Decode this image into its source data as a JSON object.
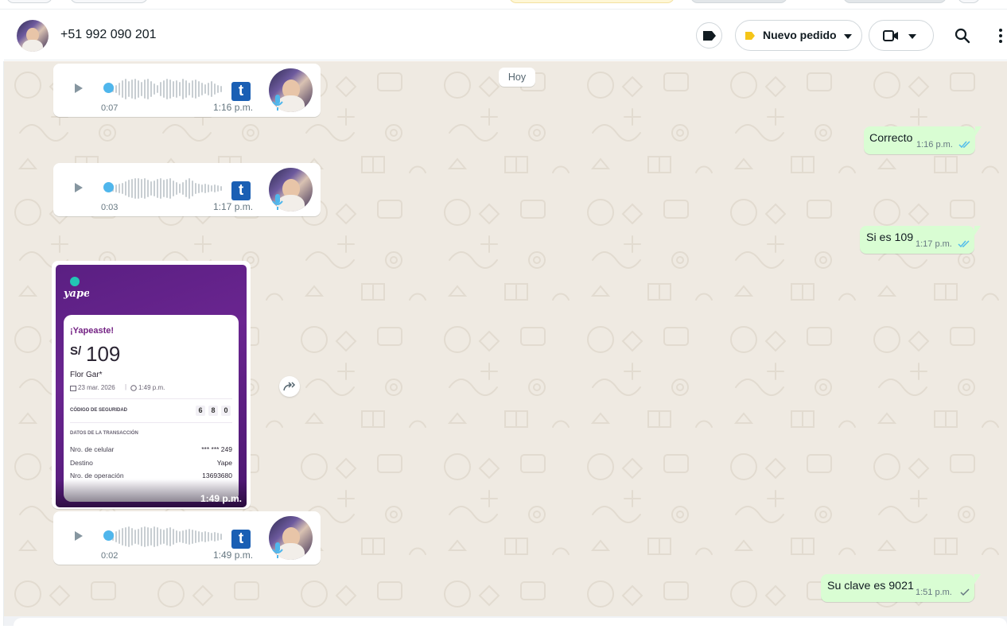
{
  "header": {
    "contact_name": "+51 992 090 201",
    "label_button": "Nuevo pedido",
    "label_color": "#f5c518",
    "icons": [
      "label-icon",
      "video-call-icon",
      "chevron-down-icon",
      "search-icon",
      "menu-icon"
    ]
  },
  "chat": {
    "day_divider": "Hoy",
    "outgoing": [
      {
        "text": "Correcto",
        "time": "1:16 p.m.",
        "status": "read"
      },
      {
        "text": "Si es 109",
        "time": "1:17 p.m.",
        "status": "read"
      },
      {
        "text": "Su clave es 9021",
        "time": "1:51 p.m.",
        "status": "sent"
      }
    ],
    "audio": [
      {
        "duration": "0:07",
        "time": "1:16 p.m."
      },
      {
        "duration": "0:03",
        "time": "1:17 p.m."
      },
      {
        "duration": "0:02",
        "time": "1:49 p.m."
      }
    ],
    "image_message": {
      "time": "1:49 p.m.",
      "receipt": {
        "brand": "yape",
        "headline": "¡Yapeaste!",
        "currency": "S/",
        "amount": "109",
        "recipient": "Flor Gar*",
        "date": "23 mar. 2026",
        "time": "1:49 p.m.",
        "security_label": "CÓDIGO DE SEGURIDAD",
        "security_code": [
          "6",
          "8",
          "0"
        ],
        "transaction_label": "DATOS DE LA TRANSACCIÓN",
        "rows": [
          {
            "label": "Nro. de celular",
            "value": "*** *** 249"
          },
          {
            "label": "Destino",
            "value": "Yape"
          },
          {
            "label": "Nro. de operación",
            "value": "13693680"
          }
        ]
      }
    }
  },
  "colors": {
    "outgoing_bubble": "#d9fdd3",
    "read_tick": "#53bdeb",
    "chat_background": "#efeae2",
    "yape_purple": "#5a1f82"
  }
}
